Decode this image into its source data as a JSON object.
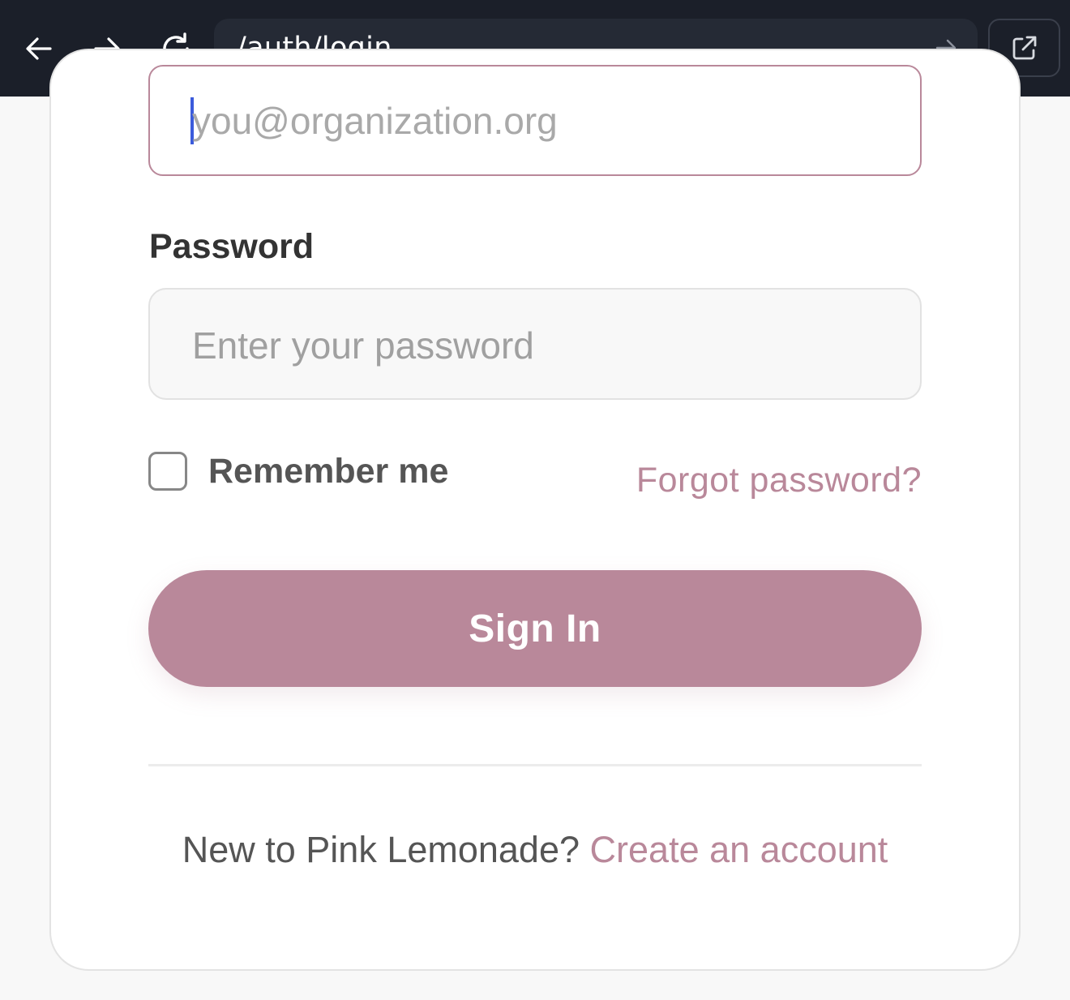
{
  "browser": {
    "url": "/auth/login",
    "icons": {
      "back": "arrow-left-icon",
      "forward": "arrow-right-icon",
      "reload": "reload-icon",
      "go": "arrow-right-icon",
      "external": "external-link-icon"
    }
  },
  "form": {
    "email": {
      "placeholder": "you@organization.org",
      "value": "",
      "focused": true
    },
    "password": {
      "label": "Password",
      "placeholder": "Enter your password",
      "value": ""
    },
    "remember": {
      "label": "Remember me",
      "checked": false
    },
    "forgot_link": "Forgot password?",
    "submit_label": "Sign In"
  },
  "footer": {
    "prompt": "New to Pink Lemonade?",
    "link": "Create an account"
  },
  "colors": {
    "accent": "#b9889a",
    "chrome_bg": "#1b1f29",
    "caret": "#3b5bdb"
  }
}
